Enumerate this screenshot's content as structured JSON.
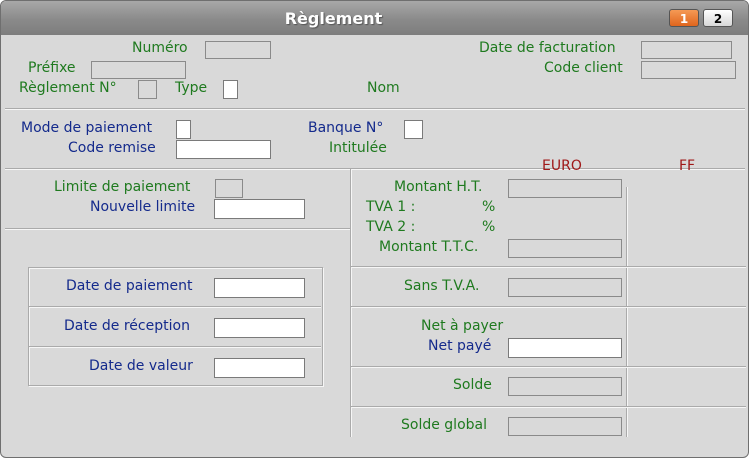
{
  "window": {
    "title": "Règlement",
    "pages": [
      "1",
      "2"
    ],
    "active_page": "1"
  },
  "header": {
    "numero_label": "Numéro",
    "prefixe_label": "Préfixe",
    "reglement_label": "Règlement N°",
    "type_label": "Type",
    "nom_label": "Nom",
    "date_facturation_label": "Date de facturation",
    "code_client_label": "Code client"
  },
  "payment": {
    "mode_label": "Mode de paiement",
    "code_remise_label": "Code remise",
    "banque_label": "Banque N°",
    "intitulee_label": "Intitulée"
  },
  "left": {
    "limite_label": "Limite de paiement",
    "nouvelle_limite_label": "Nouvelle limite",
    "date_paiement_label": "Date de paiement",
    "date_reception_label": "Date de réception",
    "date_valeur_label": "Date de valeur"
  },
  "right": {
    "euro_header": "EURO",
    "ff_header": "FF",
    "montant_ht_label": "Montant H.T.",
    "tva1_label": "TVA 1 :",
    "tva1_pct": "%",
    "tva2_label": "TVA 2 :",
    "tva2_pct": "%",
    "montant_ttc_label": "Montant T.T.C.",
    "sans_tva_label": "Sans T.V.A.",
    "net_a_payer_label": "Net à payer",
    "net_paye_label": "Net payé",
    "solde_label": "Solde",
    "solde_global_label": "Solde global"
  },
  "colors": {
    "label_green": "#1f7a1f",
    "label_blue": "#142a8c",
    "header_red": "#a01818",
    "active_page": "#e0651d"
  }
}
